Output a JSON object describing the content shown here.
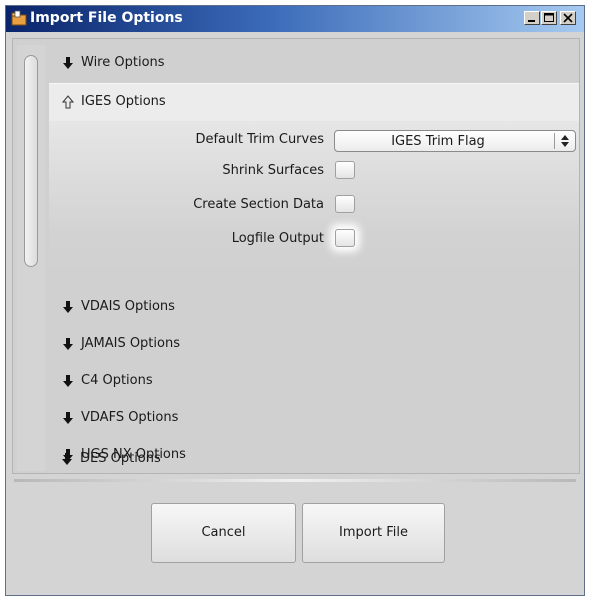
{
  "window": {
    "title": "Import File Options",
    "controls": [
      "minimize-icon",
      "maximize-icon",
      "close-icon"
    ]
  },
  "sections": [
    {
      "label": "Wire Options",
      "expanded": false
    },
    {
      "label": "IGES Options",
      "expanded": true
    },
    {
      "label": "VDAIS Options",
      "expanded": false
    },
    {
      "label": "JAMAIS Options",
      "expanded": false
    },
    {
      "label": "C4 Options",
      "expanded": false
    },
    {
      "label": "VDAFS Options",
      "expanded": false
    },
    {
      "label": "UGS NX Options",
      "expanded": false
    },
    {
      "label": "DES Options",
      "expanded": false
    }
  ],
  "iges": {
    "trim_label": "Default Trim Curves",
    "trim_value": "IGES Trim Flag",
    "shrink_label": "Shrink Surfaces",
    "shrink_checked": false,
    "section_label": "Create Section Data",
    "section_checked": false,
    "logfile_label": "Logfile Output",
    "logfile_checked": false
  },
  "buttons": {
    "cancel": "Cancel",
    "import": "Import File"
  },
  "colors": {
    "title_start": "#0a246a",
    "title_end": "#a6caf0",
    "panel": "#d0d0d0"
  }
}
